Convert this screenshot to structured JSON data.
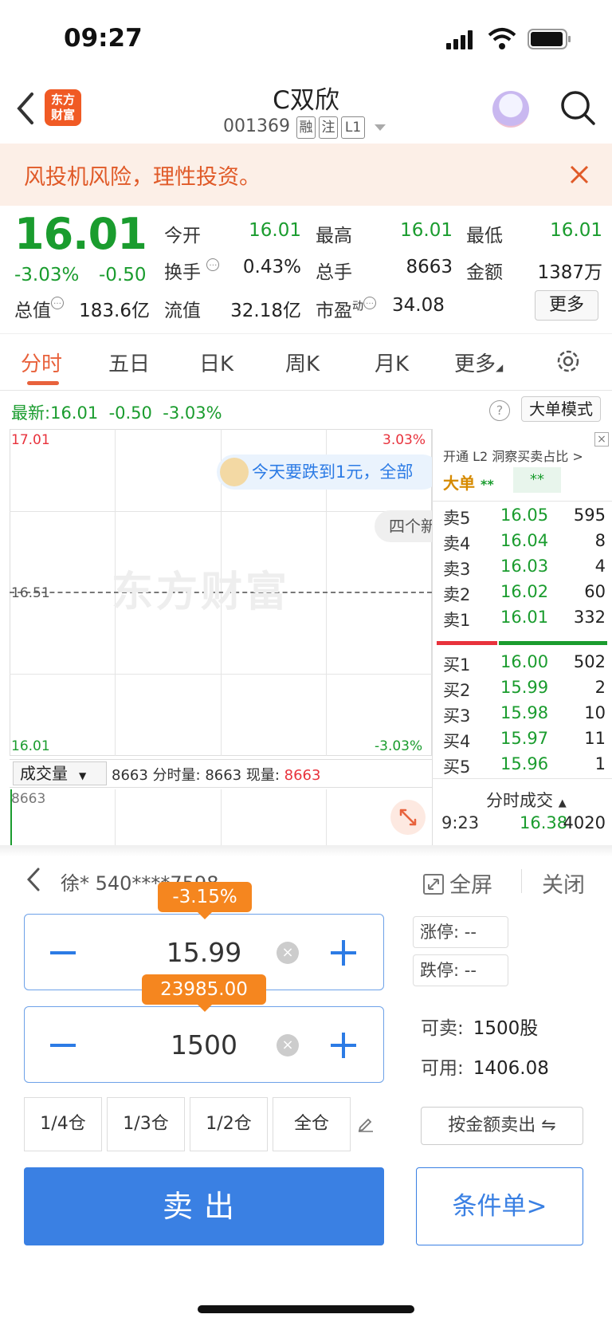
{
  "status_bar": {
    "time": "09:27"
  },
  "header": {
    "title": "C双欣",
    "code": "001369",
    "tags": [
      "融",
      "注",
      "L1"
    ]
  },
  "banner": {
    "text": "风投机风险，理性投资。"
  },
  "quote": {
    "price": "16.01",
    "change_pct": "-3.03%",
    "change": "-0.50",
    "fields": {
      "open_label": "今开",
      "open": "16.01",
      "high_label": "最高",
      "high": "16.01",
      "low_label": "最低",
      "low": "16.01",
      "turnover_label": "换手",
      "turnover": "0.43%",
      "volume_label": "总手",
      "volume": "8663",
      "amount_label": "金额",
      "amount": "1387万",
      "mktcap_label": "总值",
      "mktcap": "183.6亿",
      "float_label": "流值",
      "float": "32.18亿",
      "pe_label": "市盈",
      "pe_sup": "动",
      "pe": "34.08"
    },
    "more_label": "更多"
  },
  "tabs": [
    {
      "label": "分时"
    },
    {
      "label": "五日"
    },
    {
      "label": "日K"
    },
    {
      "label": "周K"
    },
    {
      "label": "月K"
    },
    {
      "label": "更多"
    }
  ],
  "chart": {
    "latest_label": "最新:",
    "latest_price": "16.01",
    "latest_change": "-0.50",
    "latest_pct": "-3.03%",
    "big_mode_label": "大单模式",
    "y_top": "17.01",
    "y_mid": "16.51",
    "y_bottom": "16.01",
    "pct_top": "3.03%",
    "pct_bottom": "-3.03%",
    "watermark": "东方财富",
    "message": "今天要跌到1元，全部",
    "news": "四个新",
    "volume_select": "成交量",
    "volume_info_a": "8663 分时量: 8663 现量:",
    "volume_info_b": "8663",
    "volume_top": "8663"
  },
  "order_book": {
    "l2_text": "开通 L2 洞察买卖占比 >",
    "big_label": "大单",
    "big_val": "**",
    "big_val2": "**",
    "asks": [
      {
        "label": "卖5",
        "price": "16.05",
        "qty": "595"
      },
      {
        "label": "卖4",
        "price": "16.04",
        "qty": "8"
      },
      {
        "label": "卖3",
        "price": "16.03",
        "qty": "4"
      },
      {
        "label": "卖2",
        "price": "16.02",
        "qty": "60"
      },
      {
        "label": "卖1",
        "price": "16.01",
        "qty": "332"
      }
    ],
    "bids": [
      {
        "label": "买1",
        "price": "16.00",
        "qty": "502"
      },
      {
        "label": "买2",
        "price": "15.99",
        "qty": "2"
      },
      {
        "label": "买3",
        "price": "15.98",
        "qty": "10"
      },
      {
        "label": "买4",
        "price": "15.97",
        "qty": "11"
      },
      {
        "label": "买5",
        "price": "15.96",
        "qty": "1"
      }
    ],
    "trades_title": "分时成交",
    "trade": {
      "time": "9:23",
      "price": "16.38",
      "qty": "4020"
    }
  },
  "trade_panel": {
    "account": "徐* 540****7598",
    "fullscreen": "全屏",
    "close": "关闭",
    "price_tip": "-3.15%",
    "price_value": "15.99",
    "amount_tip": "23985.00",
    "qty_value": "1500",
    "limit_up_label": "涨停:",
    "limit_up": "--",
    "limit_down_label": "跌停:",
    "limit_down": "--",
    "sellable_label": "可卖:",
    "sellable": "1500股",
    "available_label": "可用:",
    "available": "1406.08",
    "positions": [
      "1/4仓",
      "1/3仓",
      "1/2仓",
      "全仓"
    ],
    "by_amount": "按金额卖出 ⇋",
    "sell": "卖出",
    "conditional": "条件单>"
  },
  "colors": {
    "rise": "#e8323c",
    "fall": "#1a9c2e",
    "accent": "#3a80e3",
    "brand": "#f5861f"
  }
}
